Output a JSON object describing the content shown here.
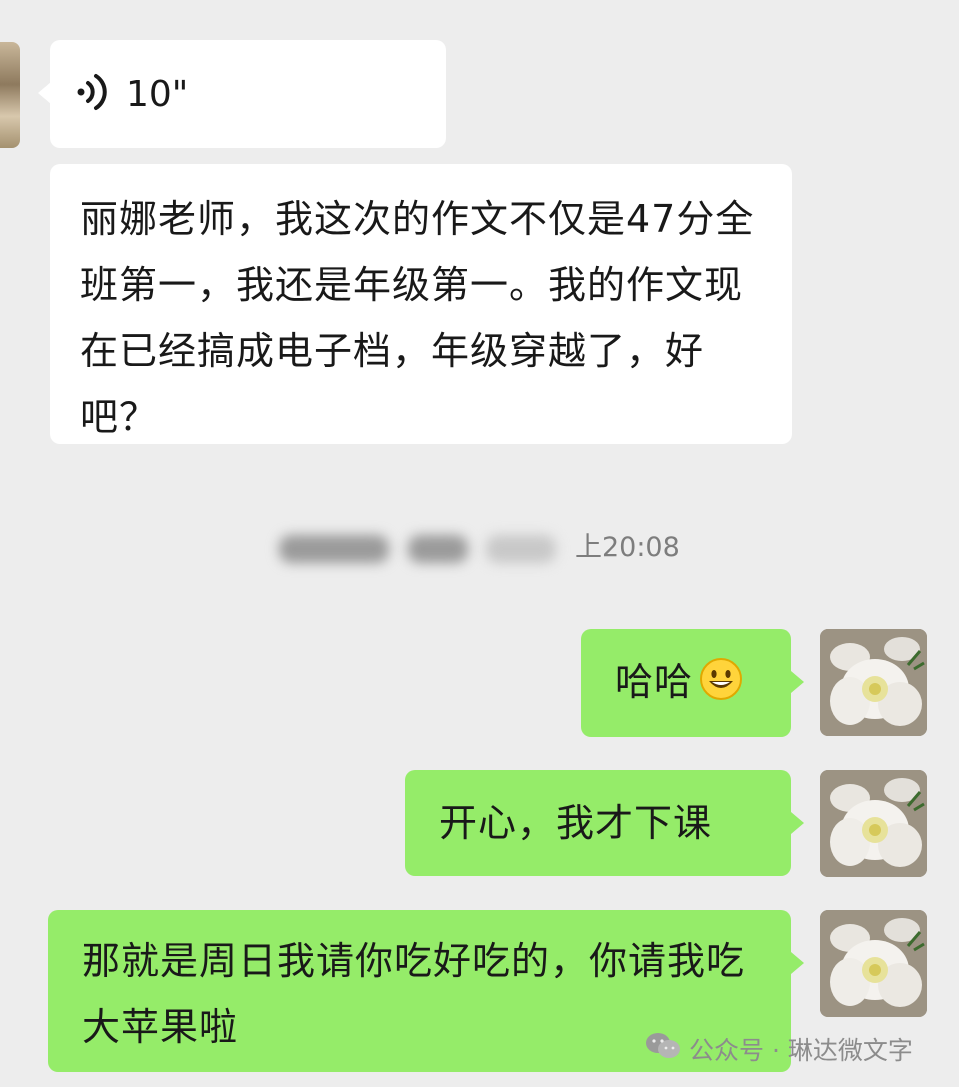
{
  "chat": {
    "voice_message": {
      "duration": "10\""
    },
    "incoming_text": "丽娜老师，我这次的作文不仅是47分全班第一，我还是年级第一。我的作文现在已经搞成电子档，年级穿越了，好吧？",
    "timestamp": "上20:08",
    "outgoing": [
      {
        "text": "哈哈"
      },
      {
        "text": "开心，我才下课"
      },
      {
        "text": "那就是周日我请你吃好吃的，你请我吃大苹果啦"
      }
    ]
  },
  "watermark": {
    "label": "公众号 · 琳达微文字"
  },
  "colors": {
    "background": "#ededed",
    "incoming_bubble": "#ffffff",
    "outgoing_bubble": "#95ec69",
    "timestamp_text": "#7d7d7d"
  },
  "icons": {
    "voice": "voice-wave-icon",
    "emoji": "smiley-face-emoji",
    "watermark": "wechat-logo-icon"
  }
}
